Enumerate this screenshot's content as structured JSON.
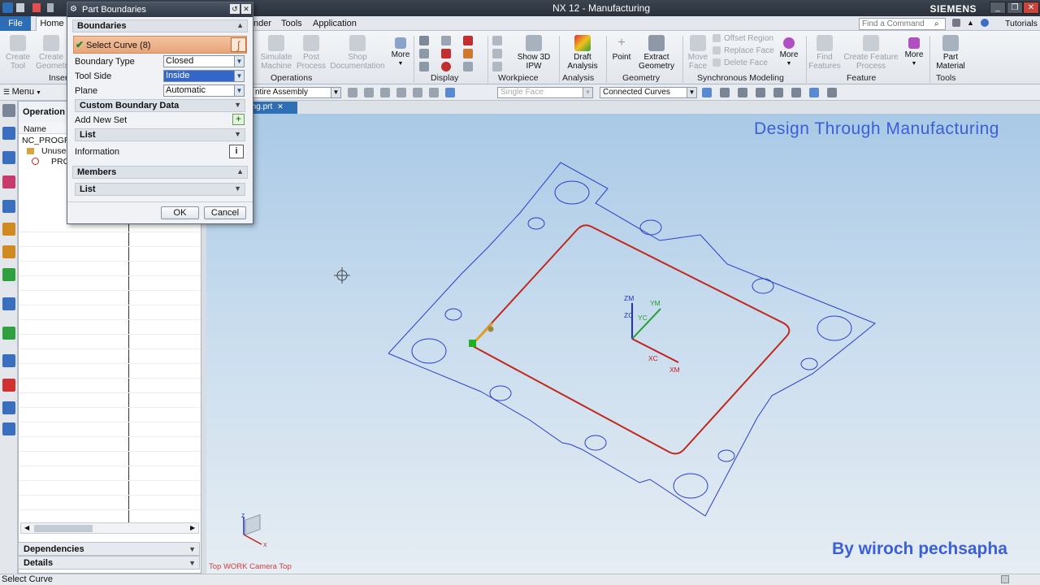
{
  "window": {
    "title": "NX 12 - Manufacturing",
    "brand": "SIEMENS"
  },
  "menu": {
    "file": "File",
    "home": "Home",
    "tabs": [
      "nder",
      "Tools",
      "Application"
    ],
    "find_placeholder": "Find a Command",
    "tutorials": "Tutorials"
  },
  "ribbon": {
    "insert": {
      "create_tool": "Create\nTool",
      "create_geometry": "Create\nGeometr",
      "group": "Inser"
    },
    "operations": {
      "simulate": "Simulate\nMachine",
      "post": "Post\nProcess",
      "shop": "Shop\nDocumentation",
      "more": "More",
      "group": "Operations"
    },
    "display": {
      "group": "Display"
    },
    "workpiece": {
      "show3d": "Show 3D\nIPW",
      "group": "Workpiece"
    },
    "analysis": {
      "draft": "Draft\nAnalysis",
      "group": "Analysis"
    },
    "geometry": {
      "point": "Point",
      "extract": "Extract\nGeometry",
      "group": "Geometry"
    },
    "sync": {
      "move_face": "Move\nFace",
      "offset_region": "Offset Region",
      "replace_face": "Replace Face",
      "delete_face": "Delete Face",
      "more": "More",
      "group": "Synchronous Modeling"
    },
    "feature": {
      "find": "Find\nFeatures",
      "create_feature_process": "Create Feature\nProcess",
      "more": "More",
      "group": "Feature"
    },
    "tools": {
      "part_material": "Part\nMaterial",
      "group": "Tools"
    }
  },
  "toolbar": {
    "menu": "Menu",
    "assembly_filter": "ntire Assembly",
    "face_filter": "Single Face",
    "curve_rule": "Connected Curves"
  },
  "file_tab": "lling.prt",
  "navigator": {
    "title": "Operation N",
    "col_name": "Name",
    "rows": [
      "NC_PROGR",
      "Unused",
      "PRO"
    ],
    "dependencies": "Dependencies",
    "details": "Details"
  },
  "dialog": {
    "title": "Part Boundaries",
    "section_boundaries": "Boundaries",
    "select_curve": "Select Curve (8)",
    "boundary_type_label": "Boundary Type",
    "boundary_type_value": "Closed",
    "tool_side_label": "Tool Side",
    "tool_side_value": "Inside",
    "plane_label": "Plane",
    "plane_value": "Automatic",
    "custom_boundary": "Custom Boundary Data",
    "add_new_set": "Add New Set",
    "list": "List",
    "information": "Information",
    "members": "Members",
    "list2": "List",
    "ok": "OK",
    "cancel": "Cancel"
  },
  "viewport": {
    "watermark_top": "Design Through Manufacturing",
    "watermark_bottom": "By wiroch  pechsapha",
    "view_label": "Top WORK Camera Top",
    "axes": {
      "zm": "ZM",
      "zc": "ZC",
      "ym": "YM",
      "yc": "YC",
      "xc": "XC",
      "xm": "XM"
    },
    "triad": {
      "z": "Z",
      "x": "X"
    }
  },
  "status": {
    "prompt": "Select Curve"
  },
  "colors": {
    "accent": "#2d6db6",
    "curve": "#c0281c",
    "outline": "#2a3fc8",
    "watermark": "#3b5fd8"
  }
}
